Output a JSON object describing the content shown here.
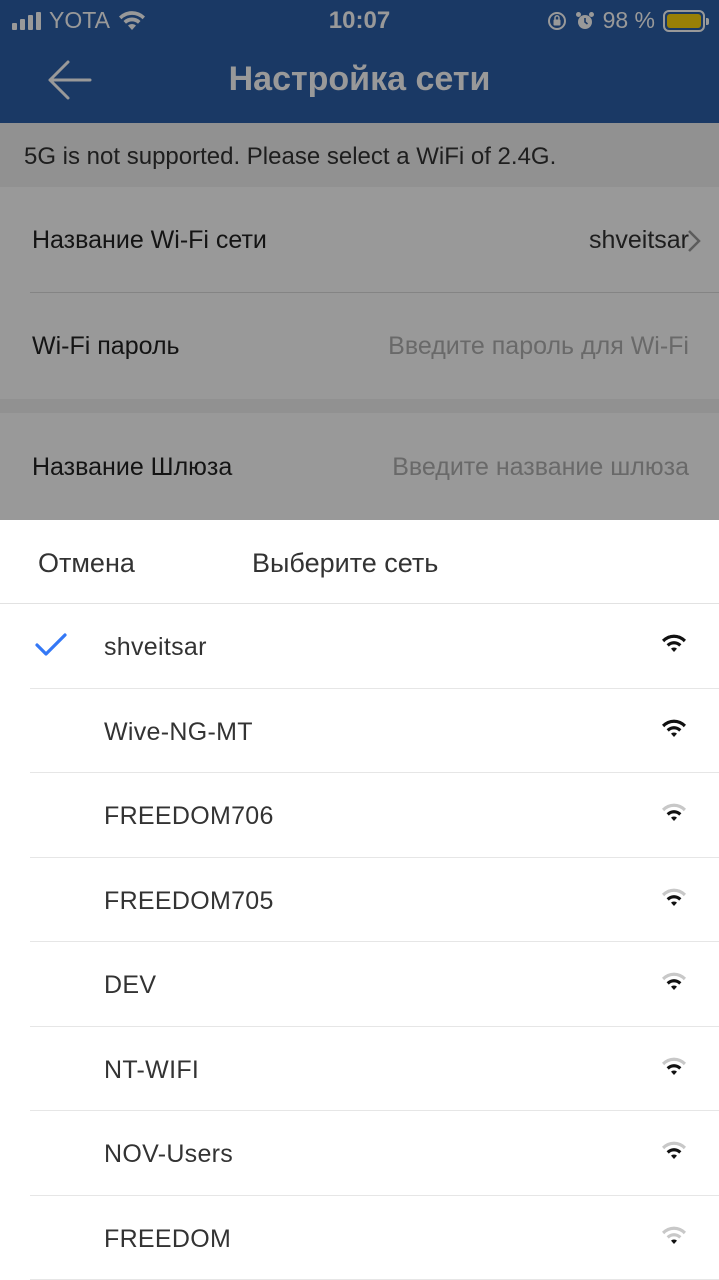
{
  "status_bar": {
    "carrier": "YOTA",
    "time": "10:07",
    "battery_percent": "98 %",
    "icons": [
      "signal-icon",
      "wifi-icon",
      "rotation-lock-icon",
      "alarm-icon",
      "battery-icon"
    ],
    "battery_color": "#ffd60a"
  },
  "header": {
    "title": "Настройка сети",
    "back_icon": "back-arrow-icon",
    "color": "#2c5fa8"
  },
  "form": {
    "notice": "5G is not supported. Please select a WiFi of  2.4G.",
    "wifi_name_label": "Название Wi-Fi сети",
    "wifi_name_value": "shveitsar",
    "wifi_password_label": "Wi-Fi пароль",
    "wifi_password_placeholder": "Введите пароль для Wi-Fi",
    "gateway_name_label": "Название Шлюза",
    "gateway_name_placeholder": "Введите название шлюза"
  },
  "sheet": {
    "cancel_label": "Отмена",
    "title": "Выберите сеть",
    "accent_color": "#3478f6",
    "networks": [
      {
        "name": "shveitsar",
        "selected": true,
        "signal_bars": 3
      },
      {
        "name": "Wive-NG-MT",
        "selected": false,
        "signal_bars": 3
      },
      {
        "name": "FREEDOM706",
        "selected": false,
        "signal_bars": 2
      },
      {
        "name": "FREEDOM705",
        "selected": false,
        "signal_bars": 2
      },
      {
        "name": "DEV",
        "selected": false,
        "signal_bars": 2
      },
      {
        "name": "NT-WIFI",
        "selected": false,
        "signal_bars": 2
      },
      {
        "name": "NOV-Users",
        "selected": false,
        "signal_bars": 2
      },
      {
        "name": "FREEDOM",
        "selected": false,
        "signal_bars": 1
      }
    ]
  }
}
